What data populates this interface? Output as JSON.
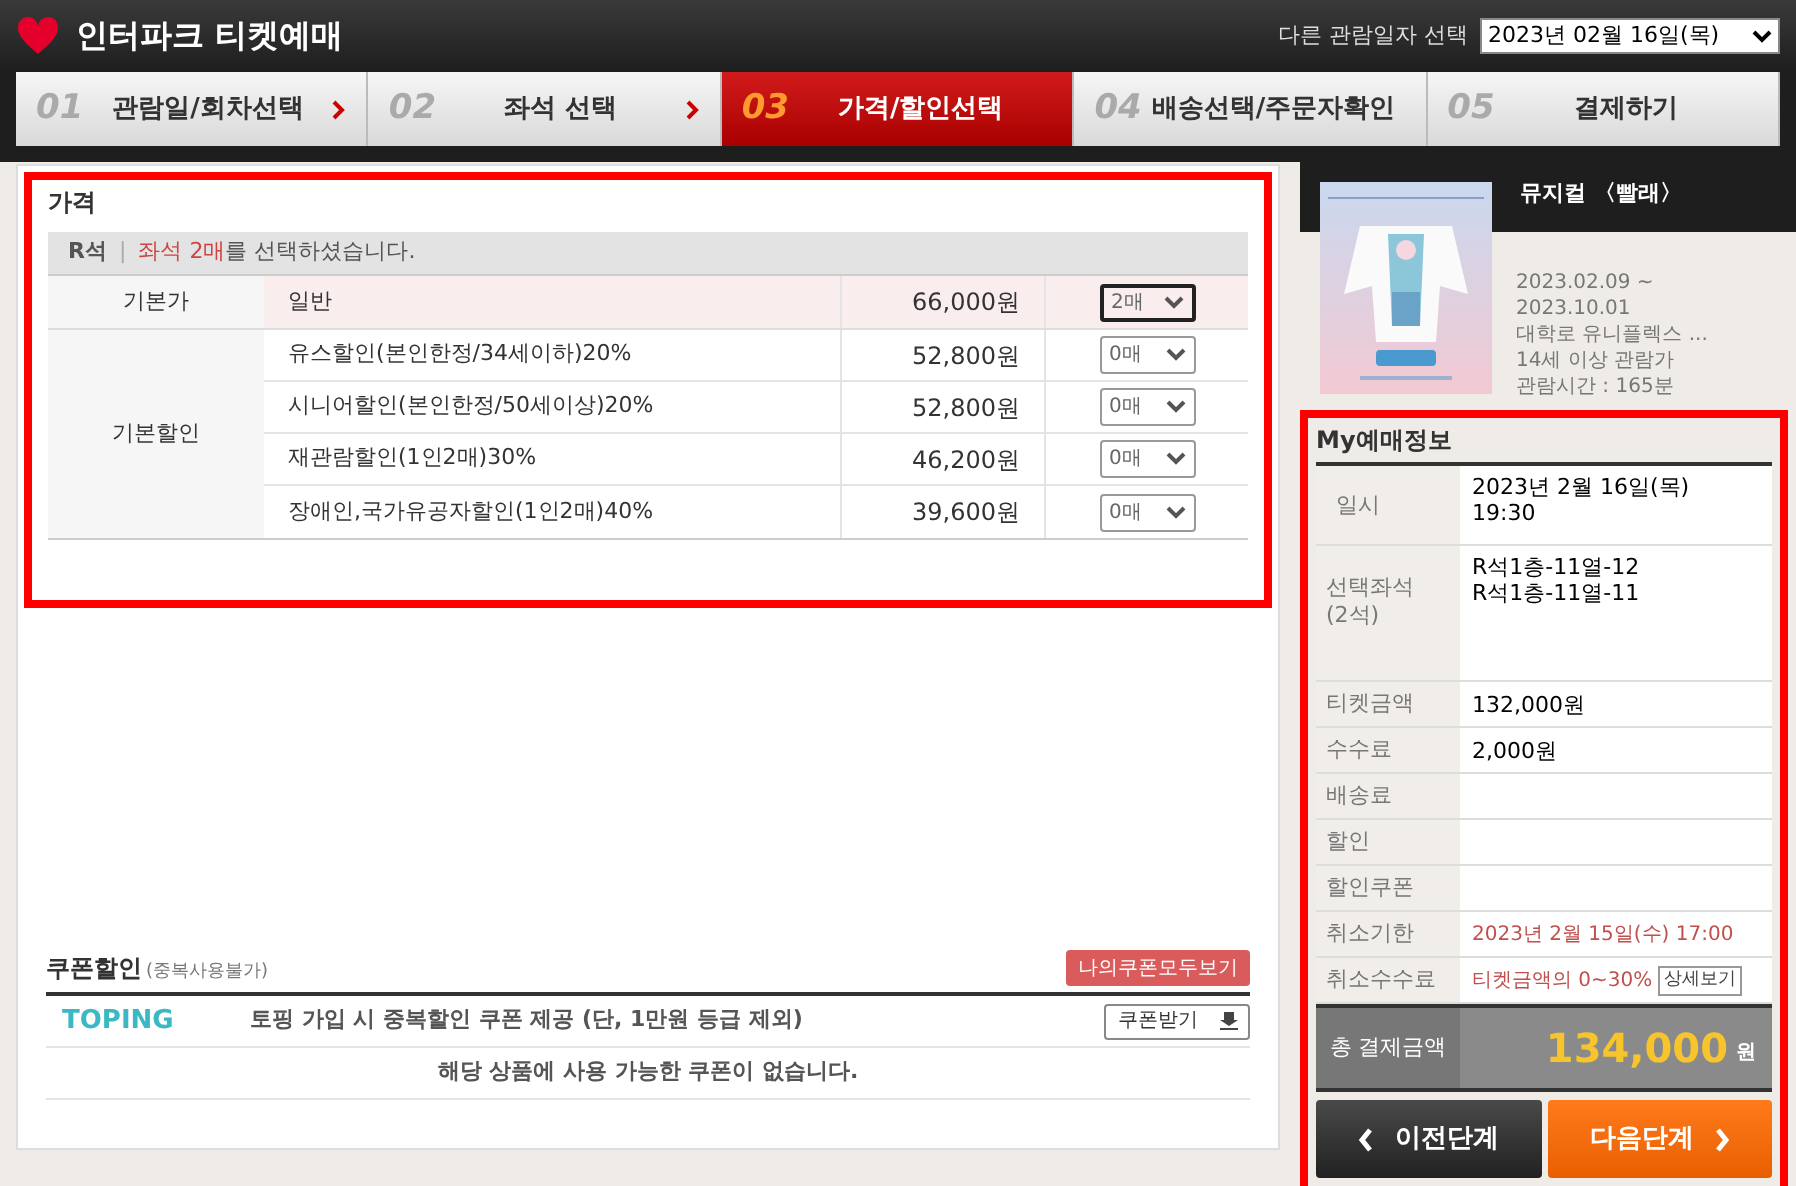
{
  "header": {
    "title": "인터파크 티켓예매",
    "date_label": "다른 관람일자 선택",
    "date_value": "2023년 02월 16일(목)"
  },
  "steps": [
    {
      "number": "01",
      "label": "관람일/회차선택",
      "selected": false
    },
    {
      "number": "02",
      "label": "좌석 선택",
      "selected": false
    },
    {
      "number": "03",
      "label": "가격/할인선택",
      "selected": true
    },
    {
      "number": "04",
      "label": "배송선택/주문자확인",
      "selected": false
    },
    {
      "number": "05",
      "label": "결제하기",
      "selected": false
    }
  ],
  "price": {
    "title": "가격",
    "grade": "R석",
    "separator": "|",
    "notice_highlight": "좌석 2매",
    "notice_rest": "를 선택하셨습니다.",
    "groups": [
      {
        "category": "기본가",
        "items": [
          {
            "name": "일반",
            "price": "66,000원",
            "quantity": "2매",
            "highlighted": true
          }
        ]
      },
      {
        "category": "기본할인",
        "items": [
          {
            "name": "유스할인(본인한정/34세이하)20%",
            "price": "52,800원",
            "quantity": "0매",
            "highlighted": false
          },
          {
            "name": "시니어할인(본인한정/50세이상)20%",
            "price": "52,800원",
            "quantity": "0매",
            "highlighted": false
          },
          {
            "name": "재관람할인(1인2매)30%",
            "price": "46,200원",
            "quantity": "0매",
            "highlighted": false
          },
          {
            "name": "장애인,국가유공자할인(1인2매)40%",
            "price": "39,600원",
            "quantity": "0매",
            "highlighted": false
          }
        ]
      }
    ]
  },
  "coupon": {
    "title": "쿠폰할인",
    "note": "(중복사용불가)",
    "view_all": "나의쿠폰모두보기",
    "logo": "TOPING",
    "promo": "토핑 가입 시 중복할인 쿠폰 제공 (단, 1만원 등급 제외)",
    "get_button": "쿠폰받기",
    "empty": "해당 상품에 사용 가능한 쿠폰이 없습니다."
  },
  "show": {
    "title": "뮤지컬 〈빨래〉",
    "details": [
      "2023.02.09 ~",
      "2023.10.01",
      "대학로 유니플렉스 ...",
      "14세 이상 관람가",
      "관람시간 : 165분"
    ]
  },
  "booking": {
    "title": "My예매정보",
    "rows": [
      {
        "kind": "tall",
        "label": [
          "일시"
        ],
        "value": [
          "2023년 2월 16일(목)",
          "19:30"
        ]
      },
      {
        "kind": "seats",
        "label": [
          "선택좌석",
          "(2석)"
        ],
        "value": [
          "R석1층-11열-12",
          "R석1층-11열-11"
        ]
      },
      {
        "kind": "normal",
        "label": [
          "티켓금액"
        ],
        "value": [
          "132,000원"
        ]
      },
      {
        "kind": "normal",
        "label": [
          "수수료"
        ],
        "value": [
          "2,000원"
        ]
      },
      {
        "kind": "normal",
        "label": [
          "배송료"
        ],
        "value": []
      },
      {
        "kind": "normal",
        "label": [
          "할인"
        ],
        "value": []
      },
      {
        "kind": "normal",
        "label": [
          "할인쿠폰"
        ],
        "value": []
      },
      {
        "kind": "cancel",
        "label": [
          "취소기한"
        ],
        "value": [
          "2023년 2월 15일(수) 17:00"
        ]
      },
      {
        "kind": "cancel",
        "label": [
          "취소수수료"
        ],
        "value": [
          "티켓금액의 0~30%"
        ],
        "button": "상세보기"
      }
    ],
    "total": {
      "label": "총 결제금액",
      "amount": "134,000",
      "unit": "원"
    },
    "prev": "이전단계",
    "next": "다음단계"
  }
}
